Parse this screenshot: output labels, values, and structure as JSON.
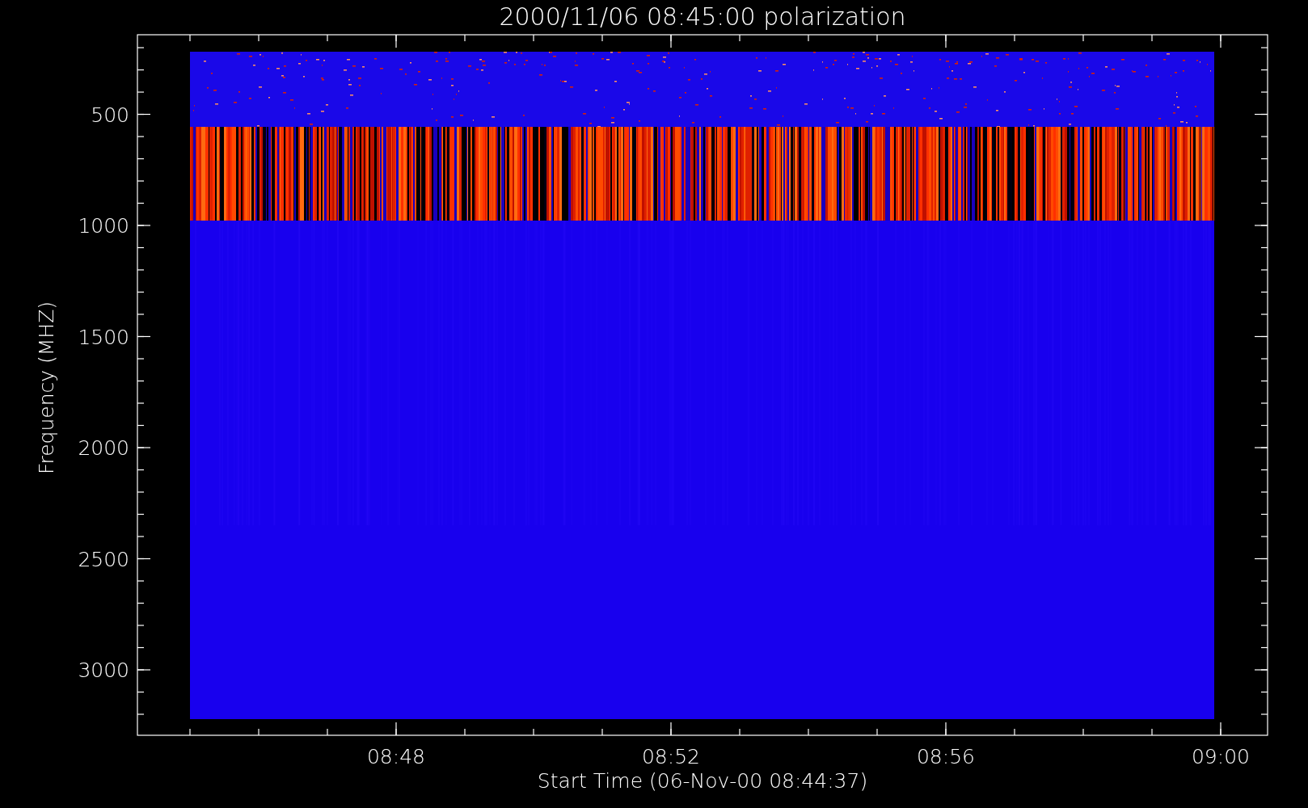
{
  "title": "2000/11/06 08:45:00 polarization",
  "y_axis": {
    "label": "Frequency (MHZ)",
    "ticks": [
      "500",
      "1000",
      "1500",
      "2000",
      "2500",
      "3000"
    ]
  },
  "x_axis": {
    "label": "Start Time (06-Nov-00 08:44:37)",
    "ticks": [
      "08:48",
      "08:52",
      "08:56",
      "09:00"
    ]
  }
}
